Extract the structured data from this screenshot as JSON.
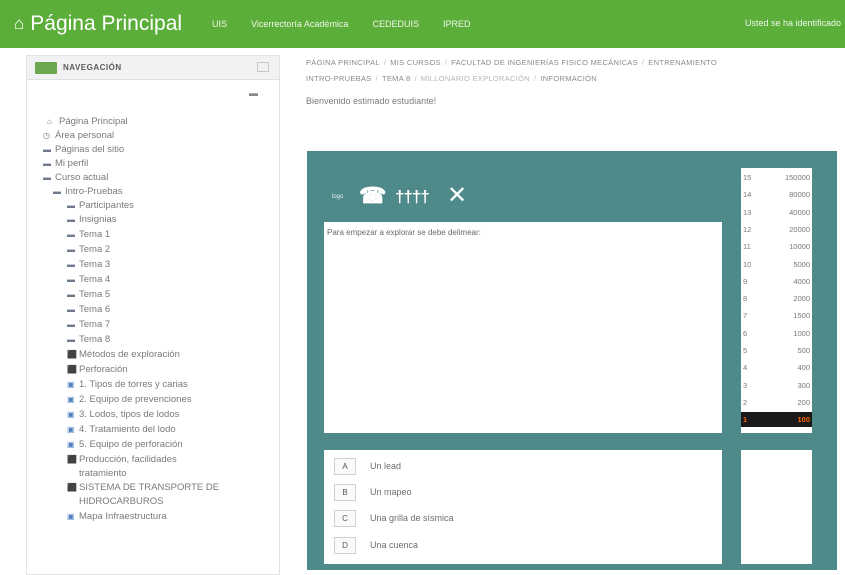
{
  "topbar": {
    "brand": "Página Principal",
    "links": [
      "UIS",
      "Vicerrectoría Académica",
      "CEDEDUIS",
      "IPRED"
    ],
    "user_notice": "Usted se ha identificado"
  },
  "nav": {
    "title": "NAVEGACIÓN",
    "items": [
      {
        "label": "Página Principal",
        "icon": "home-icon"
      },
      {
        "label": "Área personal",
        "icon": "dashboard-icon"
      },
      {
        "label": "Páginas del sitio",
        "icon": "folder-icon"
      },
      {
        "label": "Mi perfil",
        "icon": "folder-icon"
      },
      {
        "label": "Curso actual",
        "icon": "folder-icon"
      },
      {
        "label": "Intro-Pruebas",
        "icon": "folder-icon"
      },
      {
        "label": "Participantes",
        "icon": "folder-icon"
      },
      {
        "label": "Insignias",
        "icon": "folder-icon"
      },
      {
        "label": "Tema 1",
        "icon": "folder-icon"
      },
      {
        "label": "Tema 2",
        "icon": "folder-icon"
      },
      {
        "label": "Tema 3",
        "icon": "folder-icon"
      },
      {
        "label": "Tema 4",
        "icon": "folder-icon"
      },
      {
        "label": "Tema 5",
        "icon": "folder-icon"
      },
      {
        "label": "Tema 6",
        "icon": "folder-icon"
      },
      {
        "label": "Tema 7",
        "icon": "folder-icon"
      },
      {
        "label": "Tema 8",
        "icon": "folder-icon"
      },
      {
        "label": "Métodos de exploración",
        "icon": "pdf-icon"
      },
      {
        "label": "Perforación",
        "icon": "pdf-icon"
      },
      {
        "label": "1. Tipos de torres y carias",
        "icon": "doc-icon"
      },
      {
        "label": "2. Equipo de prevenciones",
        "icon": "doc-icon"
      },
      {
        "label": "3. Lodos, tipos de lodos",
        "icon": "doc-icon"
      },
      {
        "label": "4. Tratamiento del lodo",
        "icon": "doc-icon"
      },
      {
        "label": "5. Equipo de perforación",
        "icon": "doc-icon"
      },
      {
        "label": "Producción, facilidades",
        "icon": "pdf-icon"
      },
      {
        "label": "tratamiento",
        "icon": ""
      },
      {
        "label": "SISTEMA DE TRANSPORTE DE",
        "icon": "pdf-icon"
      },
      {
        "label": "HIDROCARBUROS",
        "icon": ""
      },
      {
        "label": "Mapa Infraestructura",
        "icon": "doc-icon"
      }
    ]
  },
  "breadcrumb": {
    "line1": [
      "PÁGINA PRINCIPAL",
      "MIS CURSOS",
      "FACULTAD DE INGENIERÍAS FISICO MECÁNICAS",
      "ENTRENAMIENTO"
    ],
    "line2": [
      "INTRO-PRUEBAS",
      "TEMA 8",
      "MILLONARIO EXPLORACIÓN",
      "INFORMACIÓN"
    ]
  },
  "welcome": "Bienvenido estimado estudiante!",
  "game": {
    "logo": "logo",
    "lifelines": {
      "phone": "☎",
      "audience": "††††",
      "fifty": "✕"
    },
    "question": "Para empezar a explorar se debe delimear:",
    "answers": [
      {
        "letter": "A",
        "text": "Un lead"
      },
      {
        "letter": "B",
        "text": "Un mapeo"
      },
      {
        "letter": "C",
        "text": "Una grilla de sísmica"
      },
      {
        "letter": "D",
        "text": "Una cuenca"
      }
    ],
    "ladder": [
      {
        "n": "15",
        "v": "150000"
      },
      {
        "n": "14",
        "v": "80000"
      },
      {
        "n": "13",
        "v": "40000"
      },
      {
        "n": "12",
        "v": "20000"
      },
      {
        "n": "11",
        "v": "10000"
      },
      {
        "n": "10",
        "v": "5000"
      },
      {
        "n": "9",
        "v": "4000"
      },
      {
        "n": "8",
        "v": "2000"
      },
      {
        "n": "7",
        "v": "1500"
      },
      {
        "n": "6",
        "v": "1000"
      },
      {
        "n": "5",
        "v": "500"
      },
      {
        "n": "4",
        "v": "400"
      },
      {
        "n": "3",
        "v": "300"
      },
      {
        "n": "2",
        "v": "200"
      },
      {
        "n": "1",
        "v": "100",
        "active": true
      }
    ]
  }
}
